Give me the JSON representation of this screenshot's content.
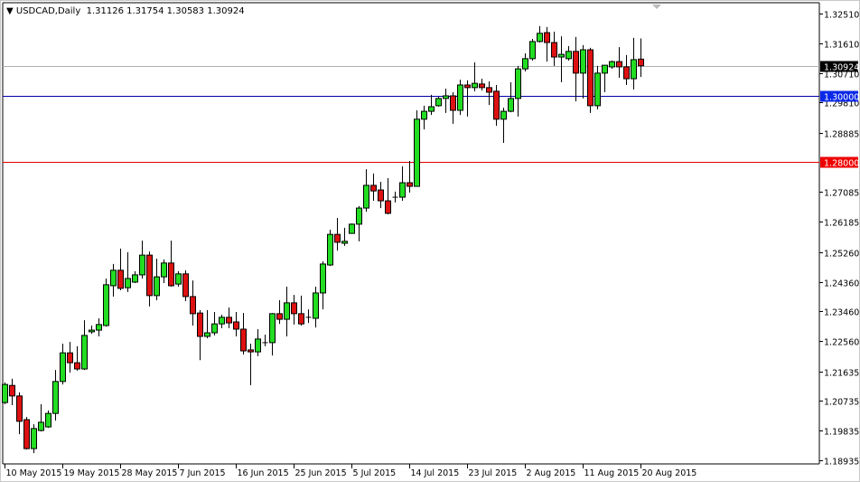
{
  "header": {
    "symbol_timeframe": "USDCAD,Daily",
    "ohlc_values": "1.31126 1.31754 1.30583 1.30924",
    "collapse_icon": "triangle-down-icon"
  },
  "colors": {
    "bull": "#22dd22",
    "bear": "#dd1111",
    "bid_line": "#b0b0b0",
    "level_1": "#0000aa",
    "level_2": "#e00000",
    "bid_label_bg": "#000000",
    "level_1_label_bg": "#0a28e8",
    "level_2_label_bg": "#ee0000"
  },
  "chart_data": {
    "type": "candlestick",
    "title": "USDCAD,Daily",
    "ylim": [
      1.18935,
      1.3251
    ],
    "grid": false,
    "y_ticks": [
      "1.32510",
      "1.31610",
      "1.30710",
      "1.29810",
      "1.28885",
      "1.27085",
      "1.26185",
      "1.25260",
      "1.24360",
      "1.23460",
      "1.22560",
      "1.21635",
      "1.20735",
      "1.19835",
      "1.18935"
    ],
    "x_labels": [
      {
        "bar": 0,
        "text": "10 May 2015"
      },
      {
        "bar": 8,
        "text": "19 May 2015"
      },
      {
        "bar": 16,
        "text": "28 May 2015"
      },
      {
        "bar": 24,
        "text": "7 Jun 2015"
      },
      {
        "bar": 32,
        "text": "16 Jun 2015"
      },
      {
        "bar": 40,
        "text": "25 Jun 2015"
      },
      {
        "bar": 48,
        "text": "5 Jul 2015"
      },
      {
        "bar": 56,
        "text": "14 Jul 2015"
      },
      {
        "bar": 64,
        "text": "23 Jul 2015"
      },
      {
        "bar": 72,
        "text": "2 Aug 2015"
      },
      {
        "bar": 80,
        "text": "11 Aug 2015"
      },
      {
        "bar": 88,
        "text": "20 Aug 2015"
      }
    ],
    "horizontal_lines": [
      {
        "name": "bid",
        "price": 1.30924,
        "label": "1.30924"
      },
      {
        "name": "level-1",
        "price": 1.3,
        "label": "1.30000"
      },
      {
        "name": "level-2",
        "price": 1.28,
        "label": "1.28000"
      }
    ],
    "ohlc": [
      [
        1.2069,
        1.213,
        1.2064,
        1.2124
      ],
      [
        1.2121,
        1.2141,
        1.2061,
        1.2089
      ],
      [
        1.2089,
        1.21,
        1.1973,
        1.2012
      ],
      [
        1.2017,
        1.2025,
        1.1926,
        1.1929
      ],
      [
        1.1929,
        1.2003,
        1.1915,
        1.199
      ],
      [
        1.1984,
        1.2064,
        1.1981,
        1.2009
      ],
      [
        1.1995,
        1.2045,
        1.1992,
        1.2036
      ],
      [
        1.2036,
        1.2168,
        1.2014,
        1.2133
      ],
      [
        1.2133,
        1.2248,
        1.2124,
        1.222
      ],
      [
        1.222,
        1.2253,
        1.216,
        1.219
      ],
      [
        1.219,
        1.224,
        1.2166,
        1.2171
      ],
      [
        1.2171,
        1.2319,
        1.2168,
        1.2273
      ],
      [
        1.2284,
        1.2303,
        1.2278,
        1.2289
      ],
      [
        1.2289,
        1.2325,
        1.227,
        1.2306
      ],
      [
        1.2303,
        1.2446,
        1.23,
        1.2427
      ],
      [
        1.2424,
        1.249,
        1.2391,
        1.2471
      ],
      [
        1.2471,
        1.2537,
        1.241,
        1.2416
      ],
      [
        1.2418,
        1.2526,
        1.2405,
        1.2446
      ],
      [
        1.2435,
        1.2468,
        1.2432,
        1.2457
      ],
      [
        1.2457,
        1.2561,
        1.2446,
        1.2517
      ],
      [
        1.2517,
        1.2528,
        1.2361,
        1.2394
      ],
      [
        1.2394,
        1.2506,
        1.238,
        1.2451
      ],
      [
        1.2451,
        1.2504,
        1.2432,
        1.2493
      ],
      [
        1.2493,
        1.2561,
        1.2421,
        1.2424
      ],
      [
        1.2429,
        1.2468,
        1.2421,
        1.246
      ],
      [
        1.246,
        1.2471,
        1.2377,
        1.2391
      ],
      [
        1.2391,
        1.244,
        1.2303,
        1.2339
      ],
      [
        1.2341,
        1.235,
        1.2198,
        1.227
      ],
      [
        1.227,
        1.235,
        1.2264,
        1.2281
      ],
      [
        1.2281,
        1.2344,
        1.2273,
        1.2308
      ],
      [
        1.2308,
        1.2336,
        1.2295,
        1.2328
      ],
      [
        1.2328,
        1.2358,
        1.2295,
        1.2311
      ],
      [
        1.2314,
        1.2344,
        1.227,
        1.2292
      ],
      [
        1.2292,
        1.2341,
        1.2215,
        1.2226
      ],
      [
        1.2229,
        1.2248,
        1.2122,
        1.2223
      ],
      [
        1.2223,
        1.2292,
        1.221,
        1.2262
      ],
      [
        1.2248,
        1.2275,
        1.224,
        1.2251
      ],
      [
        1.2251,
        1.2341,
        1.2212,
        1.2339
      ],
      [
        1.2339,
        1.238,
        1.2308,
        1.2322
      ],
      [
        1.2322,
        1.2421,
        1.227,
        1.2372
      ],
      [
        1.2372,
        1.2396,
        1.2306,
        1.2339
      ],
      [
        1.2339,
        1.2394,
        1.2303,
        1.2308
      ],
      [
        1.2328,
        1.2352,
        1.2311,
        1.2325
      ],
      [
        1.2325,
        1.2421,
        1.2297,
        1.2402
      ],
      [
        1.2402,
        1.2498,
        1.2352,
        1.249
      ],
      [
        1.2487,
        1.2594,
        1.2484,
        1.258
      ],
      [
        1.258,
        1.263,
        1.2531,
        1.2556
      ],
      [
        1.2553,
        1.26,
        1.2545,
        1.2559
      ],
      [
        1.2583,
        1.2613,
        1.2583,
        1.2611
      ],
      [
        1.2611,
        1.2666,
        1.2559,
        1.266
      ],
      [
        1.266,
        1.2778,
        1.2649,
        1.2729
      ],
      [
        1.2729,
        1.2765,
        1.2682,
        1.2712
      ],
      [
        1.2715,
        1.274,
        1.266,
        1.2682
      ],
      [
        1.2682,
        1.2751,
        1.2641,
        1.2644
      ],
      [
        1.2693,
        1.271,
        1.2677,
        1.2693
      ],
      [
        1.2693,
        1.2787,
        1.2682,
        1.2737
      ],
      [
        1.2737,
        1.2803,
        1.2707,
        1.2726
      ],
      [
        1.2726,
        1.2957,
        1.2726,
        1.293
      ],
      [
        1.293,
        1.2971,
        1.2899,
        1.2954
      ],
      [
        1.2954,
        1.3004,
        1.2943,
        1.2968
      ],
      [
        1.2971,
        1.2998,
        1.2968,
        1.2993
      ],
      [
        1.2993,
        1.3023,
        1.2949,
        1.3001
      ],
      [
        1.3001,
        1.3012,
        1.2916,
        1.2957
      ],
      [
        1.2957,
        1.305,
        1.2943,
        1.3034
      ],
      [
        1.3034,
        1.3048,
        1.2938,
        1.3026
      ],
      [
        1.3026,
        1.3103,
        1.3015,
        1.3039
      ],
      [
        1.3037,
        1.3053,
        1.3017,
        1.3026
      ],
      [
        1.3026,
        1.3045,
        1.2973,
        1.3012
      ],
      [
        1.3015,
        1.3034,
        1.291,
        1.293
      ],
      [
        1.293,
        1.2965,
        1.2858,
        1.2954
      ],
      [
        1.2954,
        1.3042,
        1.2951,
        1.2993
      ],
      [
        1.2993,
        1.3092,
        1.2938,
        1.3083
      ],
      [
        1.3083,
        1.313,
        1.3075,
        1.3114
      ],
      [
        1.3114,
        1.3174,
        1.3108,
        1.3166
      ],
      [
        1.3166,
        1.3213,
        1.3163,
        1.3191
      ],
      [
        1.3193,
        1.321,
        1.3105,
        1.3163
      ],
      [
        1.3163,
        1.3196,
        1.3092,
        1.3119
      ],
      [
        1.3119,
        1.3182,
        1.3042,
        1.3127
      ],
      [
        1.3114,
        1.3152,
        1.3108,
        1.3136
      ],
      [
        1.3136,
        1.318,
        1.2984,
        1.307
      ],
      [
        1.307,
        1.3155,
        1.2993,
        1.3141
      ],
      [
        1.3141,
        1.3147,
        1.2949,
        1.2971
      ],
      [
        1.2971,
        1.3092,
        1.296,
        1.307
      ],
      [
        1.307,
        1.3094,
        1.3012,
        1.3094
      ],
      [
        1.3089,
        1.3108,
        1.3083,
        1.3105
      ],
      [
        1.3105,
        1.3149,
        1.3056,
        1.3089
      ],
      [
        1.3089,
        1.3125,
        1.3034,
        1.3053
      ],
      [
        1.3053,
        1.3177,
        1.302,
        1.3111
      ],
      [
        1.31126,
        1.31754,
        1.30583,
        1.30924
      ]
    ]
  }
}
